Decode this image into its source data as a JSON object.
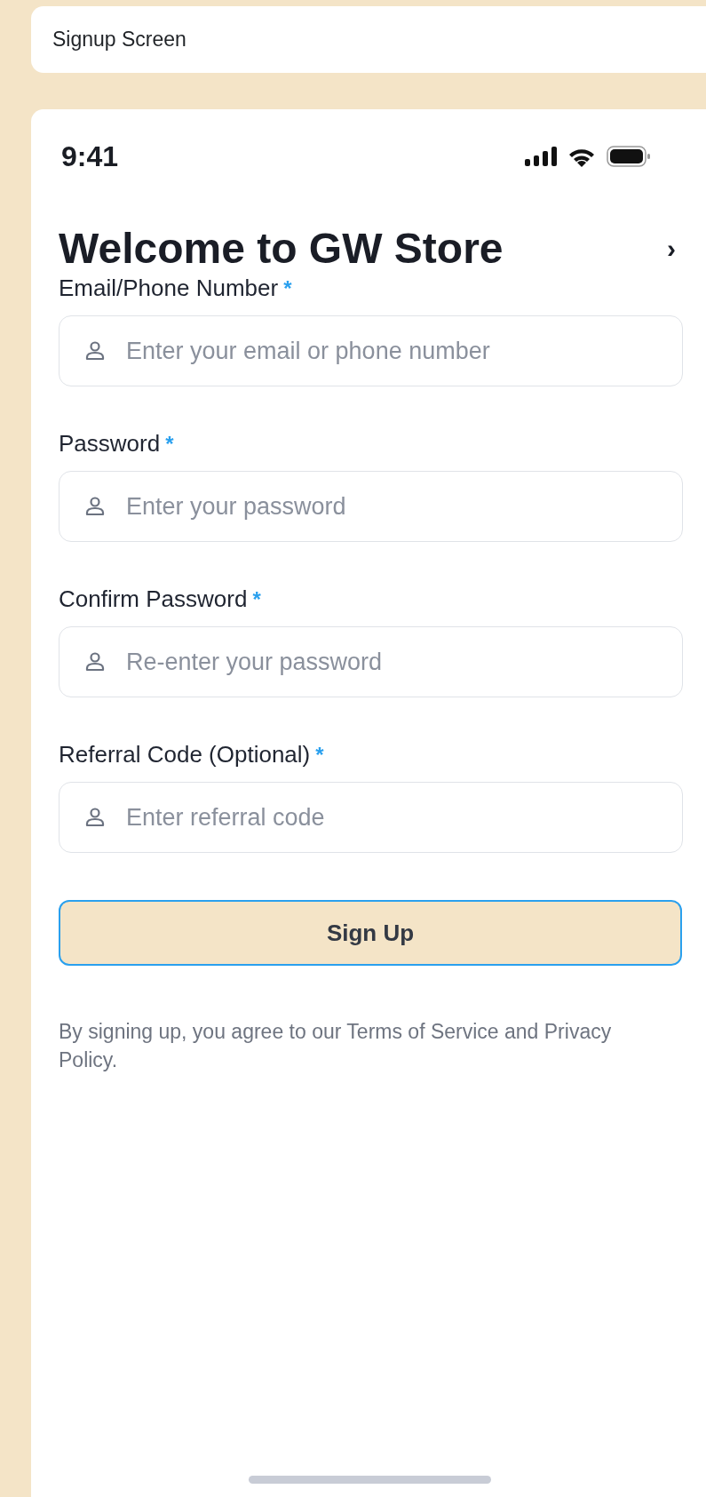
{
  "header": {
    "title": "Signup Screen"
  },
  "status_bar": {
    "time": "9:41"
  },
  "screen": {
    "title": "Welcome to GW Store",
    "next_label": "›"
  },
  "fields": [
    {
      "label": "Email/Phone Number",
      "marker": "*",
      "placeholder": "Enter your email or phone number"
    },
    {
      "label": "Password",
      "marker": "*",
      "placeholder": "Enter your password"
    },
    {
      "label": "Confirm Password",
      "marker": "*",
      "placeholder": "Re-enter your password"
    },
    {
      "label": "Referral Code (Optional)",
      "marker": "*",
      "placeholder": "Enter referral code"
    }
  ],
  "submit": {
    "label": "Sign Up"
  },
  "footer": {
    "text": "By signing up, you agree to our Terms of Service and Privacy Policy."
  }
}
